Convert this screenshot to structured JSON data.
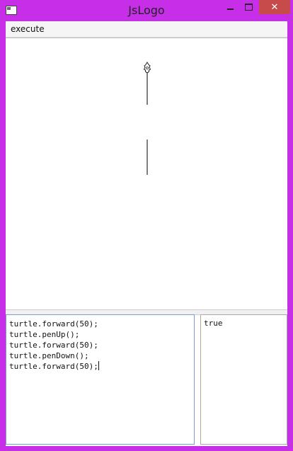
{
  "window": {
    "title": "JsLogo",
    "icons": {
      "app": "app-window-icon",
      "minimize": "minimize-icon",
      "maximize": "maximize-icon",
      "close": "close-icon"
    },
    "close_glyph": "✕",
    "colors": {
      "frame": "#c62ee8",
      "close_button": "#c74b4b"
    }
  },
  "menu": {
    "execute_label": "execute"
  },
  "editor": {
    "lines": [
      "turtle.forward(50);",
      "turtle.penUp();",
      "turtle.forward(50);",
      "turtle.penDown();",
      "turtle.forward(50);"
    ]
  },
  "output": {
    "text": "true"
  },
  "canvas": {
    "turtle_icon": "turtle-icon"
  }
}
